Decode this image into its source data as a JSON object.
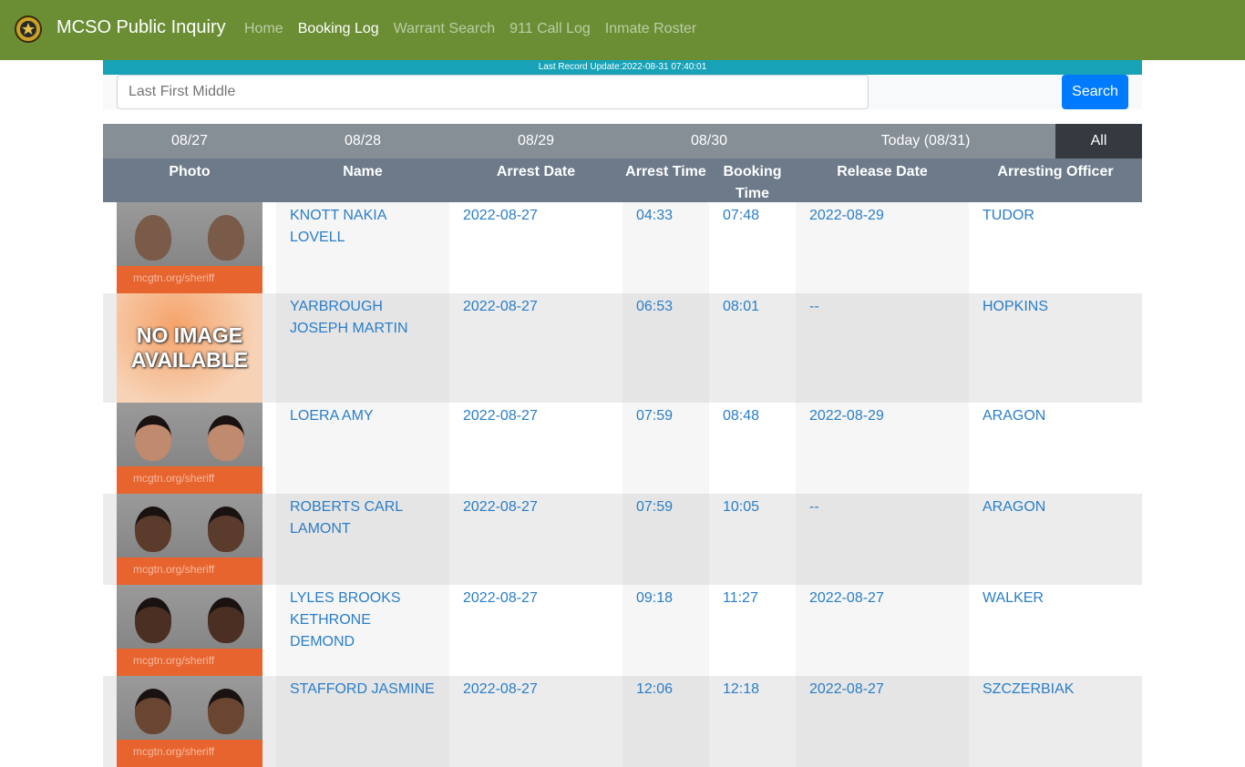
{
  "navbar": {
    "brand": "MCSO Public Inquiry",
    "links": [
      "Home",
      "Booking Log",
      "Warrant Search",
      "911 Call Log",
      "Inmate Roster"
    ],
    "active": "Booking Log"
  },
  "update_bar": "Last Record Update:2022-08-31 07:40:01",
  "search": {
    "placeholder": "Last First Middle",
    "button": "Search"
  },
  "date_tabs": [
    "08/27",
    "08/28",
    "08/29",
    "08/30",
    "Today (08/31)",
    "All"
  ],
  "columns": {
    "photo": "Photo",
    "name": "Name",
    "arrest_date": "Arrest Date",
    "arrest_time": "Arrest Time",
    "booking_time": "Booking Time",
    "release_date": "Release Date",
    "officer": "Arresting Officer"
  },
  "watermark": "mcgtn.org/sheriff",
  "no_image_text": "NO IMAGE AVAILABLE",
  "rows": [
    {
      "name": "KNOTT NAKIA LOVELL",
      "arrest_date": "2022-08-27",
      "arrest_time": "04:33",
      "booking_time": "07:48",
      "release_date": "2022-08-29",
      "officer": "TUDOR",
      "photo": "mugshot"
    },
    {
      "name": "YARBROUGH JOSEPH MARTIN",
      "arrest_date": "2022-08-27",
      "arrest_time": "06:53",
      "booking_time": "08:01",
      "release_date": "--",
      "officer": "HOPKINS",
      "photo": "none"
    },
    {
      "name": "LOERA AMY",
      "arrest_date": "2022-08-27",
      "arrest_time": "07:59",
      "booking_time": "08:48",
      "release_date": "2022-08-29",
      "officer": "ARAGON",
      "photo": "mugshot"
    },
    {
      "name": "ROBERTS CARL LAMONT",
      "arrest_date": "2022-08-27",
      "arrest_time": "07:59",
      "booking_time": "10:05",
      "release_date": "--",
      "officer": "ARAGON",
      "photo": "mugshot"
    },
    {
      "name": "LYLES BROOKS KETHRONE DEMOND",
      "arrest_date": "2022-08-27",
      "arrest_time": "09:18",
      "booking_time": "11:27",
      "release_date": "2022-08-27",
      "officer": "WALKER",
      "photo": "mugshot"
    },
    {
      "name": "STAFFORD JASMINE",
      "arrest_date": "2022-08-27",
      "arrest_time": "12:06",
      "booking_time": "12:18",
      "release_date": "2022-08-27",
      "officer": "SZCZERBIAK",
      "photo": "mugshot"
    }
  ],
  "colors": {
    "navbar": "#6b8e35",
    "update_bar": "#17a2b8",
    "link": "#2a7ec8",
    "search_button": "#007bff"
  }
}
